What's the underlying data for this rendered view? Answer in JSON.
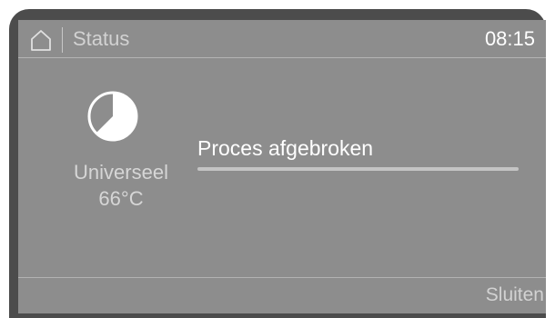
{
  "header": {
    "home_icon": "home-icon",
    "title": "Status",
    "time": "08:15"
  },
  "program": {
    "icon": "pie-progress-icon",
    "name": "Universeel",
    "temperature": "66°C"
  },
  "status": {
    "message": "Proces afgebroken"
  },
  "footer": {
    "close_label": "Sluiten"
  },
  "colors": {
    "bezel": "#4c4c4c",
    "screen": "#8d8d8d",
    "text_primary": "#ffffff",
    "text_secondary": "#d2d2d2"
  }
}
